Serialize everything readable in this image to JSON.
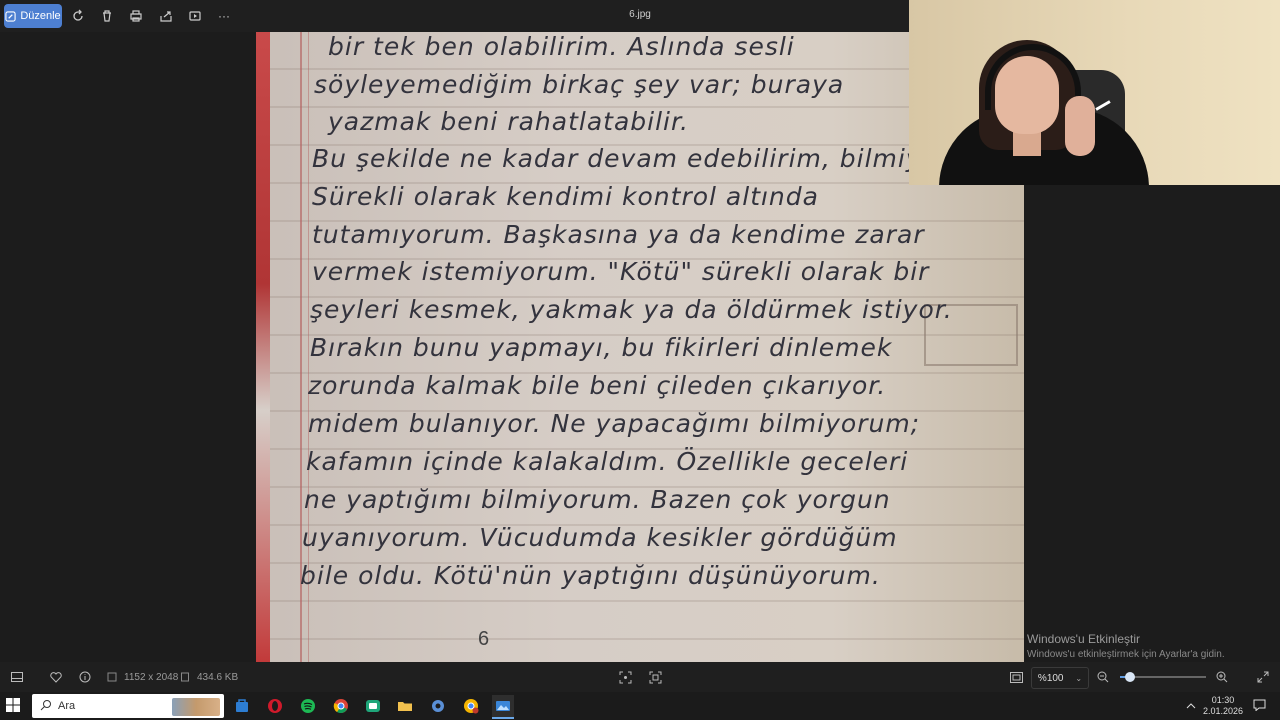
{
  "toolbar": {
    "edit_label": "Düzenle",
    "filename": "6.jpg",
    "more_label": "···"
  },
  "photo": {
    "lines": [
      "bir tek ben olabilirim. Aslında sesli",
      "söyleyemediğim birkaç şey var; buraya",
      "yazmak beni rahatlatabilir.",
      "Bu şekilde ne kadar devam edebilirim, bilmiyo",
      "Sürekli olarak kendimi kontrol altında",
      "tutamıyorum. Başkasına ya da kendime zarar",
      "vermek istemiyorum. \"Kötü\" sürekli olarak bir",
      "şeyleri kesmek, yakmak ya da öldürmek istiyor.",
      "Bırakın bunu yapmayı, bu fikirleri dinlemek",
      "zorunda kalmak bile beni çileden çıkarıyor.",
      "midem bulanıyor. Ne yapacağımı bilmiyorum;",
      "kafamın içinde kalakaldım. Özellikle geceleri",
      "ne yaptığımı bilmiyorum. Bazen çok yorgun",
      "uyanıyorum. Vücudumda kesikler gördüğüm",
      "bile oldu. Kötü'nün yaptığını düşünüyorum."
    ],
    "page_number": "6"
  },
  "watermark": {
    "title": "Windows'u Etkinleştir",
    "subtitle": "Windows'u etkinleştirmek için Ayarlar'a gidin."
  },
  "statusbar": {
    "dimensions": "1152 x 2048",
    "filesize": "434.6 KB",
    "zoom_value": "%100",
    "zoom_fraction": 0.12
  },
  "taskbar": {
    "search_label": "Ara",
    "time": "01:30",
    "date": "2.01.2026"
  },
  "colors": {
    "accent": "#4d7fd1",
    "paper": "#d6cdc6",
    "ink": "#33333d"
  }
}
